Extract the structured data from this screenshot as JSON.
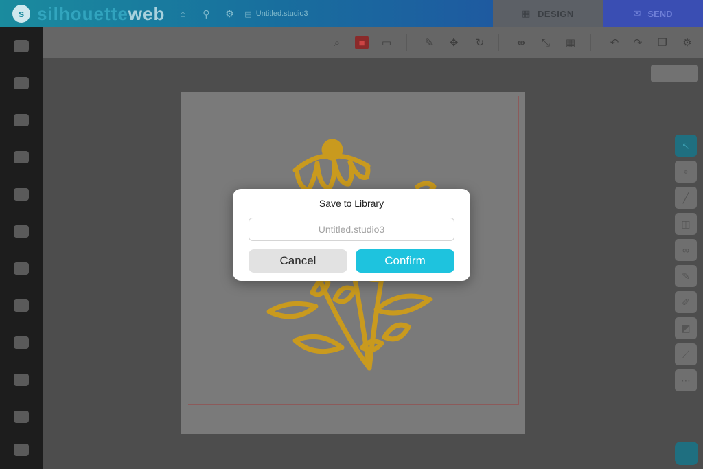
{
  "header": {
    "logo_text_a": "silhouette",
    "logo_text_b": "web",
    "logo_badge": "cs",
    "document_name": "Untitled.studio3",
    "tabs": [
      {
        "label": "DESIGN",
        "icon": "design-icon"
      },
      {
        "label": "SEND",
        "icon": "send-icon"
      }
    ]
  },
  "sidebar": {
    "items": [
      {
        "icon": "library-icon"
      },
      {
        "icon": "shapes-icon"
      },
      {
        "icon": "text-icon"
      },
      {
        "icon": "trace-icon"
      },
      {
        "icon": "draw-icon"
      },
      {
        "icon": "layout-icon"
      },
      {
        "icon": "fill-icon"
      },
      {
        "icon": "offset-icon"
      },
      {
        "icon": "effects-icon"
      },
      {
        "icon": "store-icon"
      },
      {
        "icon": "settings-icon"
      },
      {
        "icon": "folder-icon"
      }
    ]
  },
  "toolbar": {
    "tools": [
      "zoom-icon",
      "stop-icon",
      "message-icon",
      "pen-icon",
      "move-icon",
      "rotate-icon",
      "align-icon",
      "transform-icon",
      "grid-icon",
      "undo-icon",
      "redo-icon",
      "copy-icon",
      "settings-icon"
    ]
  },
  "dialog": {
    "title": "Save to Library",
    "input_placeholder": "Untitled.studio3",
    "cancel_label": "Cancel",
    "confirm_label": "Confirm"
  },
  "colors": {
    "accent": "#1ec3de",
    "send_tab": "#3a4eb3",
    "flower": "#c99a1e",
    "overlay": "#4a4a4a"
  }
}
